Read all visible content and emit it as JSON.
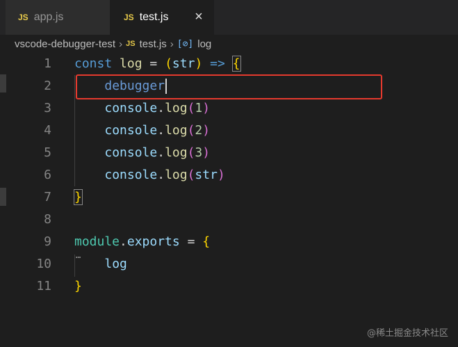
{
  "tabs": [
    {
      "badge": "JS",
      "label": "app.js",
      "active": false
    },
    {
      "badge": "JS",
      "label": "test.js",
      "active": true,
      "close": "×"
    }
  ],
  "breadcrumb": {
    "folder": "vscode-debugger-test",
    "sep": "›",
    "file_badge": "JS",
    "file": "test.js",
    "symbol_icon": "[⊘]",
    "symbol": "log"
  },
  "editor": {
    "line_numbers": [
      "1",
      "2",
      "3",
      "4",
      "5",
      "6",
      "7",
      "8",
      "9",
      "10",
      "11"
    ],
    "lines": {
      "l1": {
        "kw": "const",
        "name": "log",
        "eq": "=",
        "po": "(",
        "param": "str",
        "pc": ")",
        "arrow": "=>",
        "brace": "{"
      },
      "l2": {
        "stmt": "debugger"
      },
      "l3": {
        "obj": "console",
        "dot": ".",
        "fn": "log",
        "po": "(",
        "arg": "1",
        "pc": ")"
      },
      "l4": {
        "obj": "console",
        "dot": ".",
        "fn": "log",
        "po": "(",
        "arg": "2",
        "pc": ")"
      },
      "l5": {
        "obj": "console",
        "dot": ".",
        "fn": "log",
        "po": "(",
        "arg": "3",
        "pc": ")"
      },
      "l6": {
        "obj": "console",
        "dot": ".",
        "fn": "log",
        "po": "(",
        "arg": "str",
        "pc": ")"
      },
      "l7": {
        "brace": "}"
      },
      "l9": {
        "obj": "module",
        "dot": ".",
        "prop": "exports",
        "eq": "=",
        "brace": "{"
      },
      "l10": {
        "name": "log"
      },
      "l11": {
        "brace": "}"
      }
    },
    "fold_dots": "…"
  },
  "watermark": "@稀土掘金技术社区",
  "colors": {
    "highlight_box": "#e63a2e",
    "js_badge": "#e6c94a"
  }
}
